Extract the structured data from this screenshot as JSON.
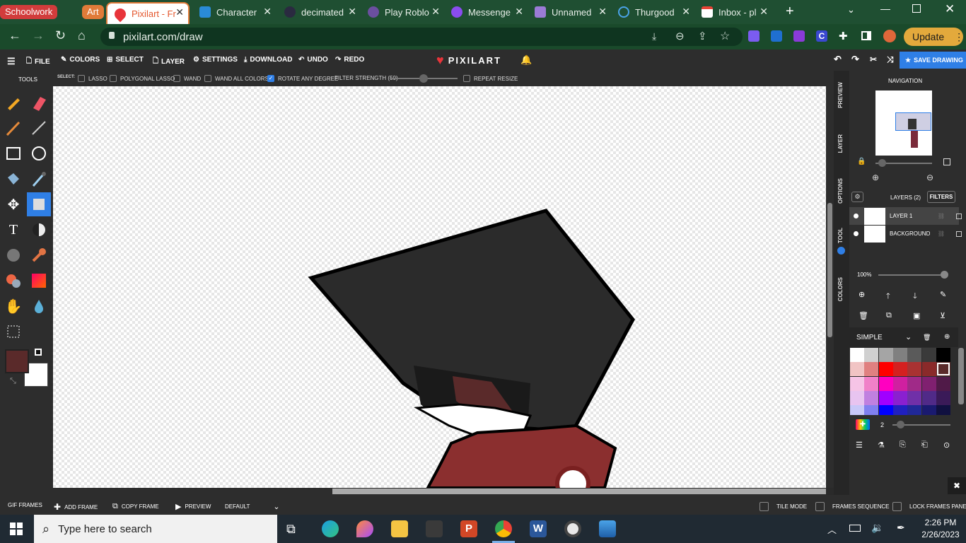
{
  "browser": {
    "tab_groups": [
      {
        "label": "Schoolwork",
        "color": "#d23c3c"
      },
      {
        "label": "Art",
        "color": "#e07b39"
      }
    ],
    "tabs": [
      {
        "title": "Pixilart - Fr",
        "active": true
      },
      {
        "title": "Character",
        "active": false
      },
      {
        "title": "decimated",
        "active": false
      },
      {
        "title": "Play Roblo",
        "active": false
      },
      {
        "title": "Messenge",
        "active": false
      },
      {
        "title": "Unnamed",
        "active": false
      },
      {
        "title": "Thurgood",
        "active": false
      },
      {
        "title": "Inbox - pl",
        "active": false
      }
    ],
    "url": "pixilart.com/draw",
    "update_label": "Update"
  },
  "menu": {
    "file": "FILE",
    "colors": "COLORS",
    "select": "SELECT",
    "layer": "LAYER",
    "settings": "SETTINGS",
    "download": "DOWNLOAD",
    "undo": "UNDO",
    "redo": "REDO",
    "logo": "PIXILART",
    "save": "SAVE DRAWING"
  },
  "select_options": {
    "prefix": "SELECT:",
    "lasso": "LASSO",
    "polygonal_lasso": "POLYGONAL LASSO",
    "wand": "WAND",
    "wand_all_colors": "WAND ALL COLORS",
    "rotate_any_degree": "ROTATE ANY DEGREE",
    "filter_strength": "FILTER STRENGTH (50)",
    "filter_strength_value": 0.5,
    "repeat_resize": "REPEAT RESIZE"
  },
  "tools": {
    "heading": "TOOLS",
    "primary_color": "#5a2a2a",
    "secondary_color": "#ffffff"
  },
  "right_panel": {
    "side_tabs": [
      "PREVIEW",
      "LAYER",
      "OPTIONS",
      "TOOL",
      "COLORS"
    ],
    "navigation_title": "NAVIGATION",
    "layers_count": "LAYERS (2)",
    "filters": "FILTERS",
    "layers": [
      "LAYER 1",
      "BACKGROUND"
    ],
    "opacity": "100%",
    "palette_name": "SIMPLE",
    "brush_size": "2",
    "palette": [
      [
        "#ffffff",
        "#d0d0d0",
        "#a5a5a5",
        "#808080",
        "#5a5a5a",
        "#3a3a3a",
        "#000000"
      ],
      [
        "#f1c4c4",
        "#e08080",
        "#ff0000",
        "#d42020",
        "#a83232",
        "#8a2a2a",
        "#5a2a2a"
      ],
      [
        "#f6c4e6",
        "#f080c8",
        "#ff00c0",
        "#d020a0",
        "#a02a88",
        "#802070",
        "#501a48"
      ],
      [
        "#e8c4f0",
        "#c080e0",
        "#a000ff",
        "#8a20d0",
        "#7030a8",
        "#502a88",
        "#3a1a58"
      ],
      [
        "#c8c8f8",
        "#8080f0",
        "#0000ff",
        "#2020c0",
        "#202898",
        "#1a1a70",
        "#101040"
      ]
    ]
  },
  "bottom_bar": {
    "gif_frames": "GIF FRAMES",
    "add_frame": "ADD FRAME",
    "copy_frame": "COPY FRAME",
    "preview": "PREVIEW",
    "speed": "DEFAULT",
    "tile_mode": "TILE MODE",
    "frames_sequence": "FRAMES SEQUENCE",
    "lock_frames_panel": "LOCK FRAMES PANEL"
  },
  "taskbar": {
    "search_placeholder": "Type here to search",
    "time": "2:26 PM",
    "date": "2/26/2023"
  }
}
